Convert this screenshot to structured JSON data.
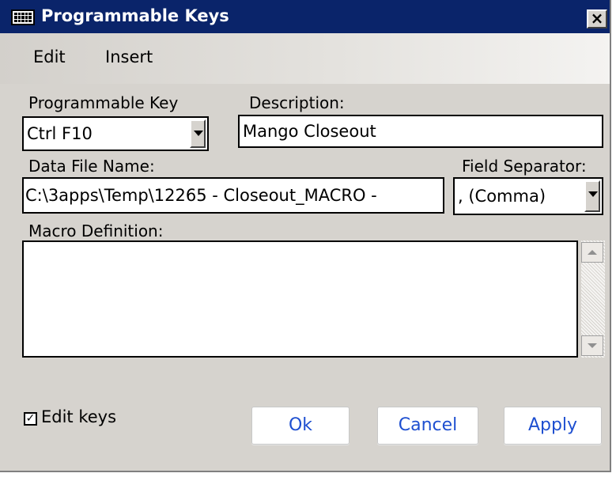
{
  "window": {
    "title": "Programmable Keys",
    "close_glyph": "×",
    "icon": "keyboard-icon"
  },
  "menu": {
    "items": [
      {
        "label": "Edit"
      },
      {
        "label": "Insert"
      }
    ]
  },
  "form": {
    "programmable_key": {
      "label": "Programmable Key",
      "value": "Ctrl F10"
    },
    "description": {
      "label": "Description:",
      "value": "Mango Closeout"
    },
    "data_file_name": {
      "label": "Data File Name:",
      "value": "C:\\3apps\\Temp\\12265 - Closeout_MACRO -"
    },
    "field_separator": {
      "label": "Field Separator:",
      "value": ", (Comma)"
    },
    "macro_definition": {
      "label": "Macro Definition:",
      "value": ""
    }
  },
  "footer": {
    "edit_keys": {
      "label": "Edit keys",
      "checked": true,
      "check_glyph": "✓"
    },
    "buttons": {
      "ok": "Ok",
      "cancel": "Cancel",
      "apply": "Apply"
    }
  },
  "colors": {
    "titlebar": "#0a246a",
    "dialog_bg": "#d6d3ce",
    "button_text": "#1e4fd0"
  }
}
